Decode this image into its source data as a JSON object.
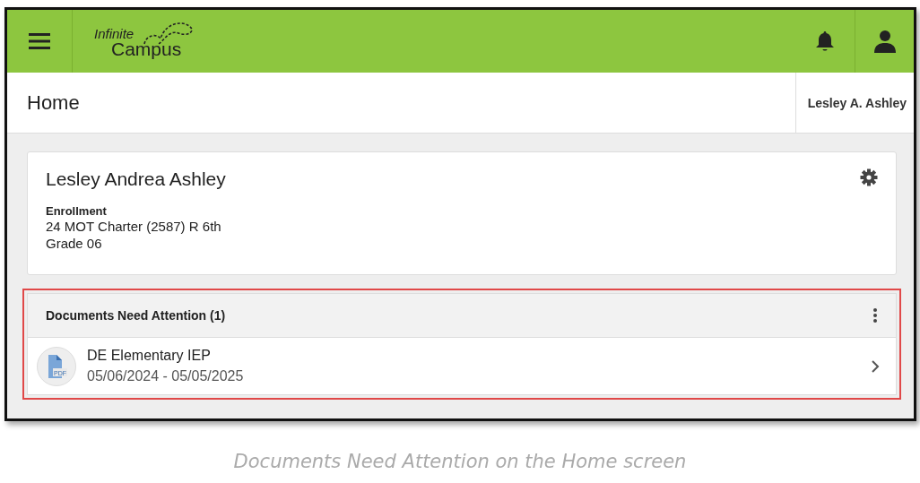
{
  "header": {
    "logo_line1": "Infinite",
    "logo_line2": "Campus"
  },
  "title_bar": {
    "title": "Home",
    "user": "Lesley A. Ashley"
  },
  "student_card": {
    "name": "Lesley Andrea Ashley",
    "section_label": "Enrollment",
    "lines": [
      "24 MOT Charter (2587) R 6th",
      "Grade 06"
    ]
  },
  "documents": {
    "title": "Documents Need Attention (1)",
    "highlighted": true,
    "items": [
      {
        "file_type": "PDF",
        "title": "DE Elementary IEP",
        "dates": "05/06/2024 - 05/05/2025"
      }
    ]
  },
  "caption": "Documents Need Attention on the Home screen"
}
